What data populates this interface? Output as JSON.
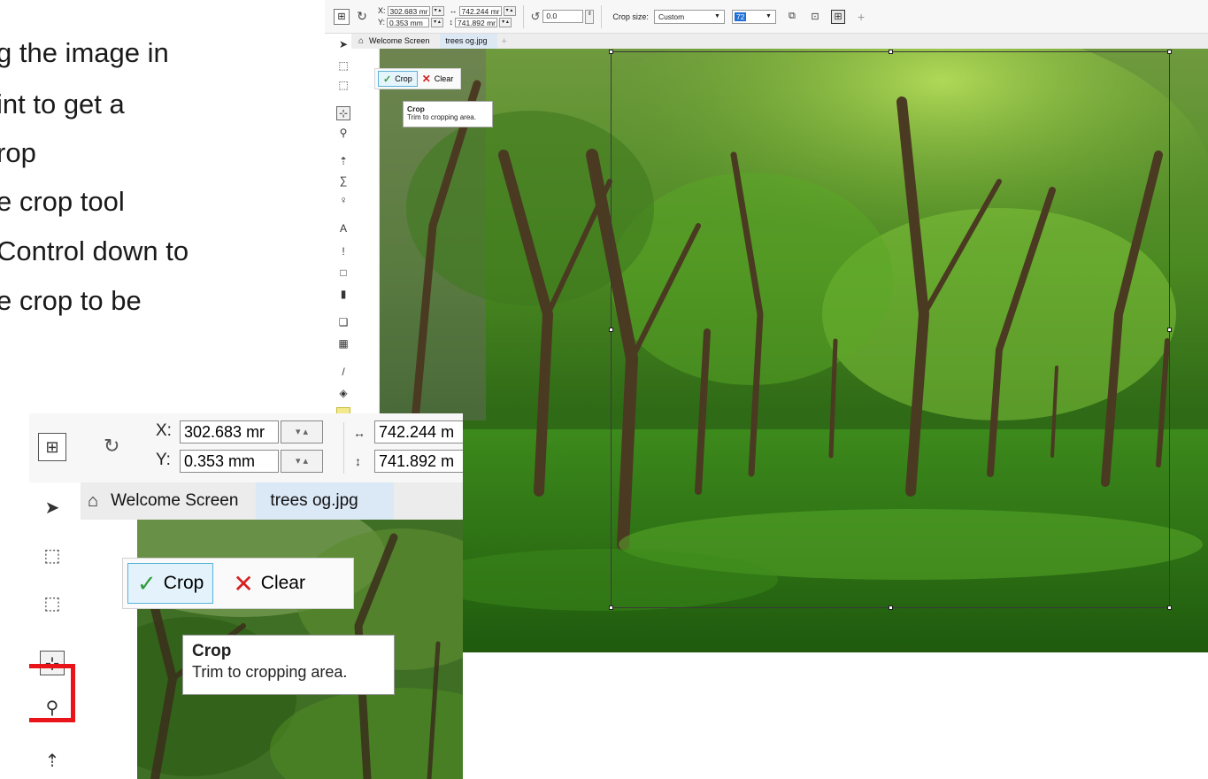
{
  "slide": {
    "lines": [
      "g the image in",
      "int to get a",
      "rop",
      "e crop tool",
      "Control down to",
      "e crop to be"
    ]
  },
  "propbar": {
    "x_label": "X:",
    "y_label": "Y:",
    "x_value": "302.683 mr",
    "y_value": "0.353 mm",
    "width_value": "742.244 mr",
    "height_value": "741.892 mr",
    "angle_value": "0.0",
    "crop_size_label": "Crop size:",
    "crop_size_value": "Custom",
    "resolution_value": "72"
  },
  "zoom_propbar": {
    "width_value": "742.244 m",
    "height_value": "741.892 m"
  },
  "tabs": {
    "welcome": "Welcome Screen",
    "document": "trees og.jpg"
  },
  "crop_popup": {
    "crop_label": "Crop",
    "clear_label": "Clear"
  },
  "tooltip": {
    "title": "Crop",
    "description": "Trim to cropping area."
  },
  "icons": {
    "pick": "pointer-arrow-icon",
    "rectangle_mask": "rectangle-mask-icon",
    "freehand_mask": "freehand-mask-icon",
    "crop": "crop-icon",
    "zoom": "magnifier-icon",
    "transparency": "object-transparency-icon",
    "text": "text-icon",
    "rectangle": "rectangle-icon",
    "fill": "fill-icon",
    "dropper": "eyedropper-icon",
    "home": "home-icon"
  },
  "colors": {
    "highlight_red": "#e8141a",
    "crop_button_border": "#59b3d9",
    "check_green": "#2f9a3a",
    "clear_red": "#d62020",
    "active_tab": "#dde8f5"
  }
}
